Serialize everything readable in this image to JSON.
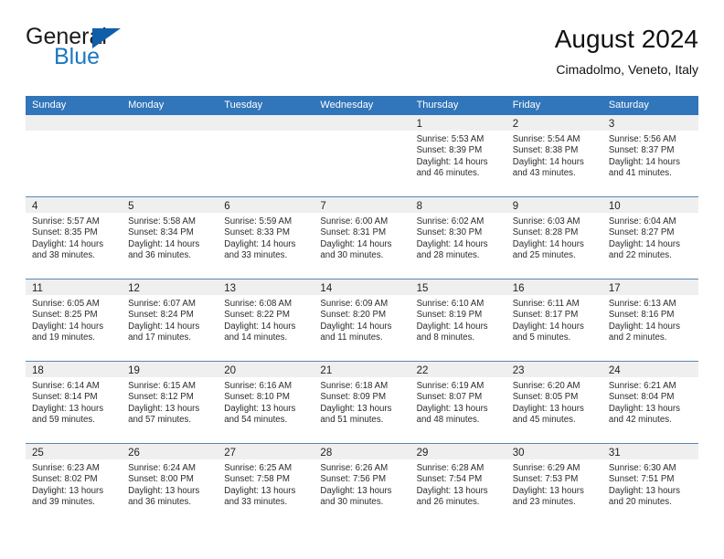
{
  "brand": {
    "name_top": "General",
    "name_bottom": "Blue",
    "accent_color": "#1b78c2",
    "triangle_color": "#0f5fa8"
  },
  "header": {
    "title": "August 2024",
    "subtitle": "Cimadolmo, Veneto, Italy"
  },
  "calendar": {
    "header_color": "#3175ba",
    "weekdays": [
      "Sunday",
      "Monday",
      "Tuesday",
      "Wednesday",
      "Thursday",
      "Friday",
      "Saturday"
    ],
    "weeks": [
      [
        {
          "day": "",
          "sunrise": "",
          "sunset": "",
          "daylight": ""
        },
        {
          "day": "",
          "sunrise": "",
          "sunset": "",
          "daylight": ""
        },
        {
          "day": "",
          "sunrise": "",
          "sunset": "",
          "daylight": ""
        },
        {
          "day": "",
          "sunrise": "",
          "sunset": "",
          "daylight": ""
        },
        {
          "day": "1",
          "sunrise": "Sunrise: 5:53 AM",
          "sunset": "Sunset: 8:39 PM",
          "daylight": "Daylight: 14 hours and 46 minutes."
        },
        {
          "day": "2",
          "sunrise": "Sunrise: 5:54 AM",
          "sunset": "Sunset: 8:38 PM",
          "daylight": "Daylight: 14 hours and 43 minutes."
        },
        {
          "day": "3",
          "sunrise": "Sunrise: 5:56 AM",
          "sunset": "Sunset: 8:37 PM",
          "daylight": "Daylight: 14 hours and 41 minutes."
        }
      ],
      [
        {
          "day": "4",
          "sunrise": "Sunrise: 5:57 AM",
          "sunset": "Sunset: 8:35 PM",
          "daylight": "Daylight: 14 hours and 38 minutes."
        },
        {
          "day": "5",
          "sunrise": "Sunrise: 5:58 AM",
          "sunset": "Sunset: 8:34 PM",
          "daylight": "Daylight: 14 hours and 36 minutes."
        },
        {
          "day": "6",
          "sunrise": "Sunrise: 5:59 AM",
          "sunset": "Sunset: 8:33 PM",
          "daylight": "Daylight: 14 hours and 33 minutes."
        },
        {
          "day": "7",
          "sunrise": "Sunrise: 6:00 AM",
          "sunset": "Sunset: 8:31 PM",
          "daylight": "Daylight: 14 hours and 30 minutes."
        },
        {
          "day": "8",
          "sunrise": "Sunrise: 6:02 AM",
          "sunset": "Sunset: 8:30 PM",
          "daylight": "Daylight: 14 hours and 28 minutes."
        },
        {
          "day": "9",
          "sunrise": "Sunrise: 6:03 AM",
          "sunset": "Sunset: 8:28 PM",
          "daylight": "Daylight: 14 hours and 25 minutes."
        },
        {
          "day": "10",
          "sunrise": "Sunrise: 6:04 AM",
          "sunset": "Sunset: 8:27 PM",
          "daylight": "Daylight: 14 hours and 22 minutes."
        }
      ],
      [
        {
          "day": "11",
          "sunrise": "Sunrise: 6:05 AM",
          "sunset": "Sunset: 8:25 PM",
          "daylight": "Daylight: 14 hours and 19 minutes."
        },
        {
          "day": "12",
          "sunrise": "Sunrise: 6:07 AM",
          "sunset": "Sunset: 8:24 PM",
          "daylight": "Daylight: 14 hours and 17 minutes."
        },
        {
          "day": "13",
          "sunrise": "Sunrise: 6:08 AM",
          "sunset": "Sunset: 8:22 PM",
          "daylight": "Daylight: 14 hours and 14 minutes."
        },
        {
          "day": "14",
          "sunrise": "Sunrise: 6:09 AM",
          "sunset": "Sunset: 8:20 PM",
          "daylight": "Daylight: 14 hours and 11 minutes."
        },
        {
          "day": "15",
          "sunrise": "Sunrise: 6:10 AM",
          "sunset": "Sunset: 8:19 PM",
          "daylight": "Daylight: 14 hours and 8 minutes."
        },
        {
          "day": "16",
          "sunrise": "Sunrise: 6:11 AM",
          "sunset": "Sunset: 8:17 PM",
          "daylight": "Daylight: 14 hours and 5 minutes."
        },
        {
          "day": "17",
          "sunrise": "Sunrise: 6:13 AM",
          "sunset": "Sunset: 8:16 PM",
          "daylight": "Daylight: 14 hours and 2 minutes."
        }
      ],
      [
        {
          "day": "18",
          "sunrise": "Sunrise: 6:14 AM",
          "sunset": "Sunset: 8:14 PM",
          "daylight": "Daylight: 13 hours and 59 minutes."
        },
        {
          "day": "19",
          "sunrise": "Sunrise: 6:15 AM",
          "sunset": "Sunset: 8:12 PM",
          "daylight": "Daylight: 13 hours and 57 minutes."
        },
        {
          "day": "20",
          "sunrise": "Sunrise: 6:16 AM",
          "sunset": "Sunset: 8:10 PM",
          "daylight": "Daylight: 13 hours and 54 minutes."
        },
        {
          "day": "21",
          "sunrise": "Sunrise: 6:18 AM",
          "sunset": "Sunset: 8:09 PM",
          "daylight": "Daylight: 13 hours and 51 minutes."
        },
        {
          "day": "22",
          "sunrise": "Sunrise: 6:19 AM",
          "sunset": "Sunset: 8:07 PM",
          "daylight": "Daylight: 13 hours and 48 minutes."
        },
        {
          "day": "23",
          "sunrise": "Sunrise: 6:20 AM",
          "sunset": "Sunset: 8:05 PM",
          "daylight": "Daylight: 13 hours and 45 minutes."
        },
        {
          "day": "24",
          "sunrise": "Sunrise: 6:21 AM",
          "sunset": "Sunset: 8:04 PM",
          "daylight": "Daylight: 13 hours and 42 minutes."
        }
      ],
      [
        {
          "day": "25",
          "sunrise": "Sunrise: 6:23 AM",
          "sunset": "Sunset: 8:02 PM",
          "daylight": "Daylight: 13 hours and 39 minutes."
        },
        {
          "day": "26",
          "sunrise": "Sunrise: 6:24 AM",
          "sunset": "Sunset: 8:00 PM",
          "daylight": "Daylight: 13 hours and 36 minutes."
        },
        {
          "day": "27",
          "sunrise": "Sunrise: 6:25 AM",
          "sunset": "Sunset: 7:58 PM",
          "daylight": "Daylight: 13 hours and 33 minutes."
        },
        {
          "day": "28",
          "sunrise": "Sunrise: 6:26 AM",
          "sunset": "Sunset: 7:56 PM",
          "daylight": "Daylight: 13 hours and 30 minutes."
        },
        {
          "day": "29",
          "sunrise": "Sunrise: 6:28 AM",
          "sunset": "Sunset: 7:54 PM",
          "daylight": "Daylight: 13 hours and 26 minutes."
        },
        {
          "day": "30",
          "sunrise": "Sunrise: 6:29 AM",
          "sunset": "Sunset: 7:53 PM",
          "daylight": "Daylight: 13 hours and 23 minutes."
        },
        {
          "day": "31",
          "sunrise": "Sunrise: 6:30 AM",
          "sunset": "Sunset: 7:51 PM",
          "daylight": "Daylight: 13 hours and 20 minutes."
        }
      ]
    ]
  }
}
